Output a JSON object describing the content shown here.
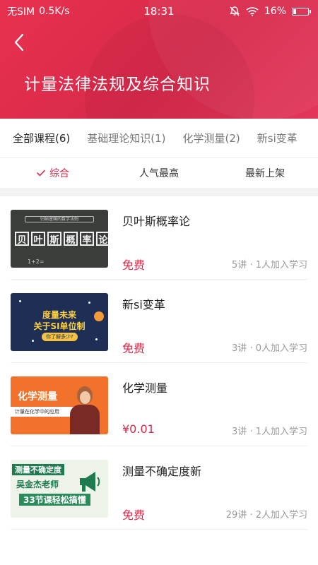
{
  "status_bar": {
    "carrier": "无SIM",
    "speed": "0.5K/s",
    "time": "18:31",
    "battery_percent": "16%",
    "battery_level": 0.16
  },
  "header": {
    "title": "计量法律法规及综合知识",
    "back_icon": "chevron-left-icon"
  },
  "tabs": [
    {
      "label": "全部课程(6)",
      "active": true
    },
    {
      "label": "基础理论知识(1)",
      "active": false
    },
    {
      "label": "化学测量(2)",
      "active": false
    },
    {
      "label": "新si变革",
      "active": false
    }
  ],
  "sort": [
    {
      "label": "综合",
      "active": true
    },
    {
      "label": "人气最高",
      "active": false
    },
    {
      "label": "最新上架",
      "active": false
    }
  ],
  "courses": [
    {
      "title": "贝叶斯概率论",
      "price": "免费",
      "meta": "5讲 · 1人加入学习",
      "thumb": {
        "banner": "归纳逻辑的数学法则",
        "chars": [
          "贝",
          "叶",
          "斯",
          "概",
          "率",
          "论"
        ],
        "formula": "1+2="
      }
    },
    {
      "title": "新si变革",
      "price": "免费",
      "meta": "3讲 · 0人加入学习",
      "thumb": {
        "line1": "度量未来",
        "line2": "关于SI单位制",
        "pill": "你了解多少?"
      }
    },
    {
      "title": "化学测量",
      "price": "¥0.01",
      "meta": "3讲 · 1人加入学习",
      "thumb": {
        "title": "化学测量",
        "bar": "计量在化学中的应用"
      }
    },
    {
      "title": "测量不确定度新",
      "price": "免费",
      "meta": "29讲 · 2人加入学习",
      "thumb": {
        "line1": "测量不确定度",
        "line2": "吴金杰老师",
        "line3": "33节课轻松搞懂"
      }
    }
  ],
  "colors": {
    "accent": "#d8294a",
    "header_bg": "#e03050",
    "muted": "#999999"
  }
}
